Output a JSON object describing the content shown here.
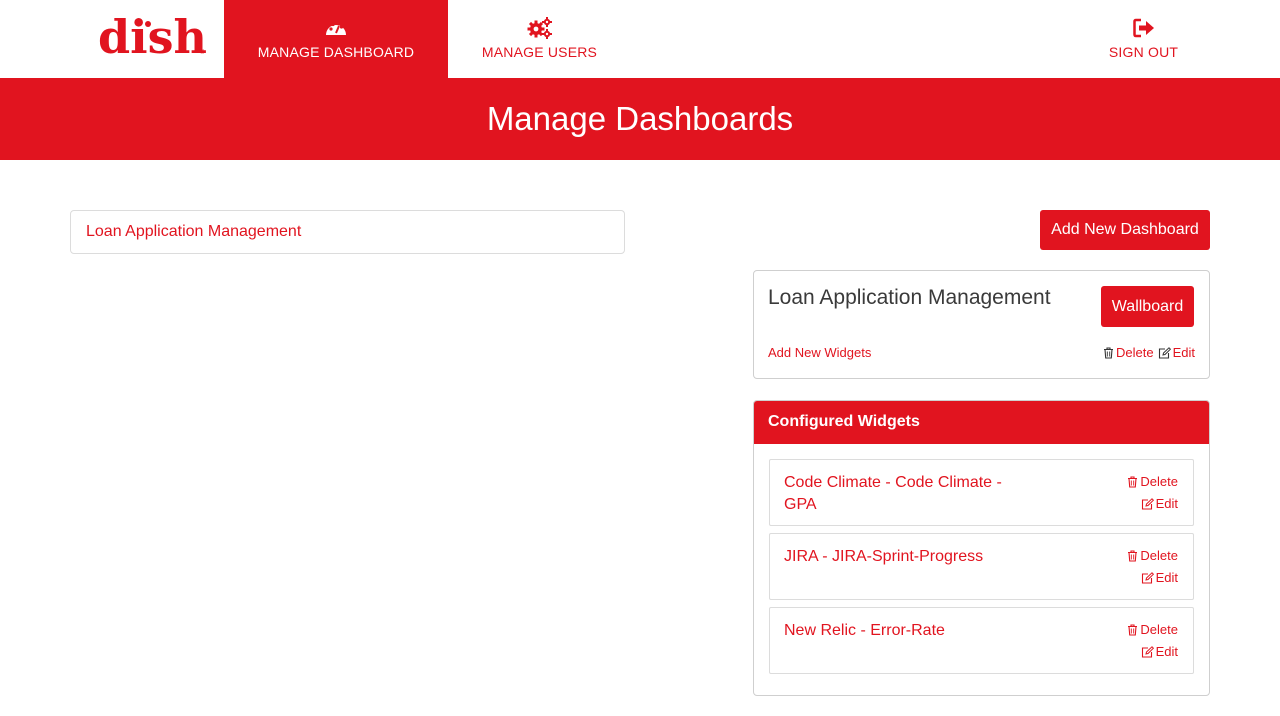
{
  "brand": {
    "logo_text": "dish",
    "accent": "#e1141f"
  },
  "nav": {
    "items": [
      {
        "label": "MANAGE DASHBOARD",
        "icon": "dashboard-gauge-icon",
        "active": true
      },
      {
        "label": "MANAGE USERS",
        "icon": "gears-icon",
        "active": false
      },
      {
        "label": "SIGN OUT",
        "icon": "sign-out-icon",
        "active": false
      }
    ]
  },
  "page": {
    "title": "Manage Dashboards"
  },
  "dashboards": [
    {
      "name": "Loan Application Management"
    }
  ],
  "add_dashboard_label": "Add New Dashboard",
  "selected_dashboard": {
    "name": "Loan Application Management",
    "wallboard_label": "Wallboard",
    "add_widgets_label": "Add New Widgets",
    "delete_label": "Delete",
    "edit_label": "Edit"
  },
  "configured_widgets": {
    "heading": "Configured Widgets",
    "items": [
      {
        "name": "Code Climate - Code Climate - GPA",
        "delete_label": "Delete",
        "edit_label": "Edit"
      },
      {
        "name": "JIRA - JIRA-Sprint-Progress",
        "delete_label": "Delete",
        "edit_label": "Edit"
      },
      {
        "name": "New Relic - Error-Rate",
        "delete_label": "Delete",
        "edit_label": "Edit"
      }
    ]
  }
}
